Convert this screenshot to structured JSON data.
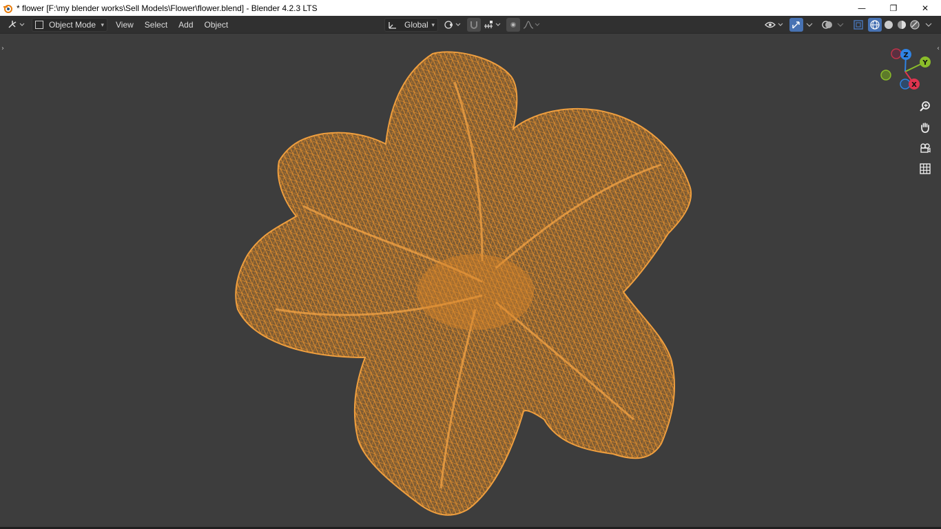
{
  "window": {
    "title": "* flower [F:\\my blender works\\Sell Models\\Flower\\flower.blend] - Blender 4.2.3 LTS",
    "controls": {
      "minimize": "—",
      "restore": "❐",
      "close": "✕"
    }
  },
  "header": {
    "mode": "Object Mode",
    "menu": [
      "View",
      "Select",
      "Add",
      "Object"
    ],
    "orientation": "Global"
  },
  "viewport": {
    "object": "flower",
    "display": "wireframe",
    "selected": true
  },
  "gizmo": {
    "axes": [
      "Z",
      "Y",
      "X"
    ]
  },
  "icons": {
    "editor_type": "viewport-icon",
    "zoom": "zoom-icon",
    "pan": "hand-icon",
    "camera": "camera-icon",
    "ortho": "grid-icon"
  },
  "colors": {
    "wire": "#e8922e",
    "background": "#3d3d3d",
    "header": "#303030",
    "accent": "#4772b3",
    "axis_x": "#e0344f",
    "axis_y": "#8bbd2a",
    "axis_z": "#2f83e4"
  }
}
